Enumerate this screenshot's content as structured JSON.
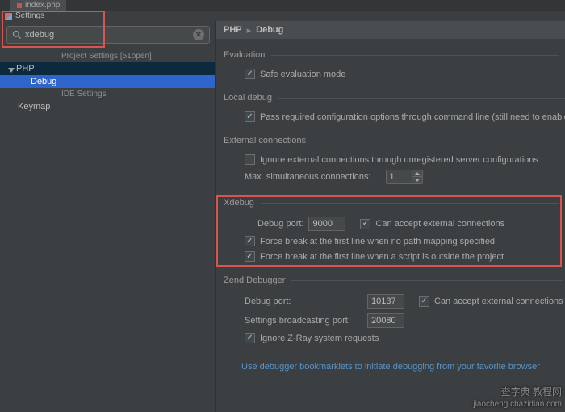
{
  "editor_tab": {
    "label": "index.php"
  },
  "window": {
    "title": "Settings"
  },
  "search": {
    "value": "xdebug"
  },
  "sidebar": {
    "cat_project": "Project Settings [51open]",
    "php": "PHP",
    "debug": "Debug",
    "cat_ide": "IDE Settings",
    "keymap": "Keymap"
  },
  "breadcrumb": {
    "a": "PHP",
    "b": "Debug"
  },
  "evaluation": {
    "legend": "Evaluation",
    "safe": "Safe evaluation mode"
  },
  "localdebug": {
    "legend": "Local debug",
    "pass": "Pass required configuration options through command line (still need to enable debug extens"
  },
  "external": {
    "legend": "External connections",
    "ignore": "Ignore external connections through unregistered server configurations",
    "maxlabel": "Max. simultaneous connections:",
    "maxvalue": "1"
  },
  "xdebug": {
    "legend": "Xdebug",
    "portlabel": "Debug port:",
    "port": "9000",
    "accept": "Can accept external connections",
    "break_nomap": "Force break at the first line when no path mapping specified",
    "break_outside": "Force break at the first line when a script is outside the project"
  },
  "zend": {
    "legend": "Zend Debugger",
    "portlabel": "Debug port:",
    "port": "10137",
    "accept": "Can accept external connections",
    "bclabel": "Settings broadcasting port:",
    "bcport": "20080",
    "zray": "Ignore Z-Ray system requests"
  },
  "footer_link": "Use debugger bookmarklets to initiate debugging from your favorite browser",
  "watermark": {
    "top": "查字典 教程网",
    "bottom": "jiaocheng.chazidian.com"
  }
}
